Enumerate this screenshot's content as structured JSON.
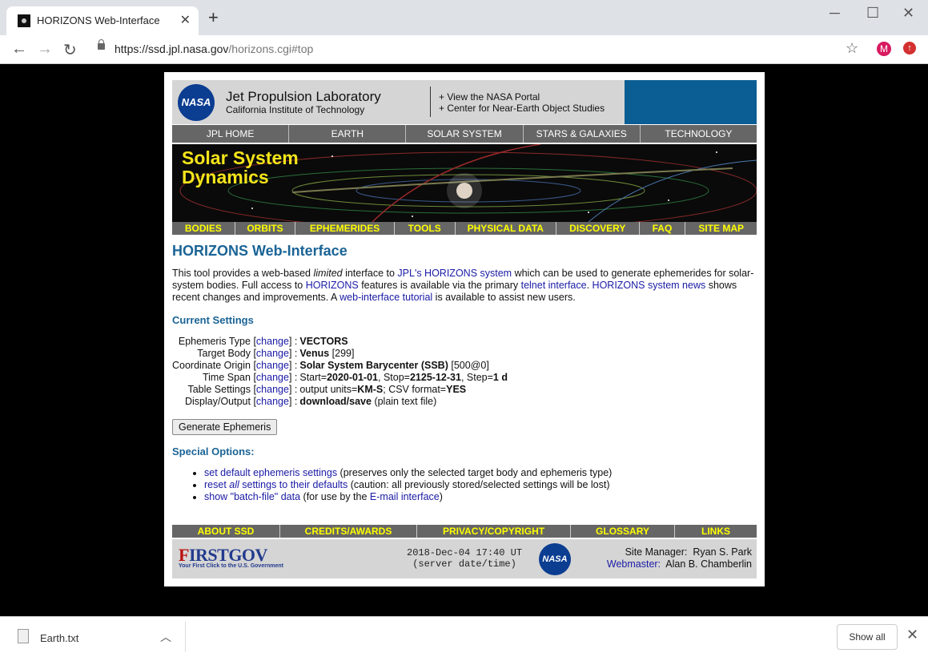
{
  "browser": {
    "tab_title": "HORIZONS Web-Interface",
    "url_host": "https://ssd.jpl.nasa.gov",
    "url_path": "/horizons.cgi#top",
    "profile_initial": "M"
  },
  "header": {
    "nasa": "NASA",
    "jpl_title": "Jet Propulsion Laboratory",
    "jpl_subtitle": "California Institute of Technology",
    "link1": "+ View the NASA Portal",
    "link2": "+ Center for Near-Earth Object Studies"
  },
  "top_nav": [
    "JPL HOME",
    "EARTH",
    "SOLAR SYSTEM",
    "STARS & GALAXIES",
    "TECHNOLOGY"
  ],
  "banner": {
    "line1": "Solar System",
    "line2": "Dynamics"
  },
  "sub_nav": [
    "BODIES",
    "ORBITS",
    "EPHEMERIDES",
    "TOOLS",
    "PHYSICAL DATA",
    "DISCOVERY",
    "FAQ",
    "SITE MAP"
  ],
  "main": {
    "title": "HORIZONS Web-Interface",
    "intro": {
      "p1": "This tool provides a web-based ",
      "p1_em": "limited",
      "p2": " interface to ",
      "link_jpl": "JPL's HORIZONS system",
      "p3": " which can be used to generate ephemerides for solar-system bodies. Full access to ",
      "link_horizons": "HORIZONS",
      "p4": " features is available via the primary ",
      "link_telnet": "telnet interface",
      "p5": ". ",
      "link_news": "HORIZONS system news",
      "p6": " shows recent changes and improvements. A ",
      "link_tutorial": "web-interface tutorial",
      "p7": " is available to assist new users."
    },
    "current_settings_heading": "Current Settings",
    "change_label": "change",
    "settings": {
      "eph_type_label": "Ephemeris Type",
      "eph_type_value": "VECTORS",
      "target_label": "Target Body",
      "target_value": "Venus",
      "target_id": "[299]",
      "origin_label": "Coordinate Origin",
      "origin_value": "Solar System Barycenter (SSB)",
      "origin_id": "[500@0]",
      "span_label": "Time Span",
      "span_start_label": "Start=",
      "span_start": "2020-01-01",
      "span_stop_label": ", Stop=",
      "span_stop": "2125-12-31",
      "span_step_label": ", Step=",
      "span_step": "1 d",
      "table_label": "Table Settings",
      "table_units_label": "output units=",
      "table_units": "KM-S",
      "table_csv_label": "; CSV format=",
      "table_csv": "YES",
      "display_label": "Display/Output",
      "display_value": "download/save",
      "display_note": " (plain text file)"
    },
    "generate_button": "Generate Ephemeris",
    "special_heading": "Special Options:",
    "options": {
      "o1_link": "set default ephemeris settings",
      "o1_text": " (preserves only the selected target body and ephemeris type)",
      "o2_link_a": "reset ",
      "o2_link_em": "all",
      "o2_link_b": " settings to their defaults",
      "o2_text": " (caution: all previously stored/selected settings will be lost)",
      "o3_link": "show \"batch-file\" data",
      "o3_text_a": " (for use by the ",
      "o3_link2": "E-mail interface",
      "o3_text_b": ")"
    }
  },
  "footer_nav": [
    "ABOUT SSD",
    "CREDITS/AWARDS",
    "PRIVACY/COPYRIGHT",
    "GLOSSARY",
    "LINKS"
  ],
  "footer": {
    "firstgov_first": "F",
    "firstgov_irst": "IRST",
    "firstgov_gov": "GOV",
    "firstgov_tag": "Your First Click to the U.S. Government",
    "server_time": "2018-Dec-04 17:40 UT",
    "server_note": "(server date/time)",
    "nasa": "NASA",
    "site_manager_label": "Site Manager:",
    "site_manager": "Ryan S. Park",
    "webmaster_label": "Webmaster:",
    "webmaster": "Alan B. Chamberlin"
  },
  "downloads": {
    "file": "Earth.txt",
    "show_all": "Show all"
  }
}
